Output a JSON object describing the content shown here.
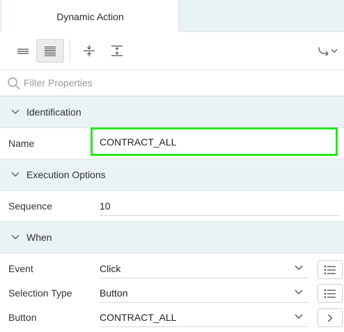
{
  "tabs": [
    {
      "label": "Dynamic Action"
    }
  ],
  "toolbar": {
    "buttons": [
      {
        "icon": "show-common-icon"
      },
      {
        "icon": "show-all-icon",
        "active": true
      },
      {
        "icon": "collapse-all-icon"
      },
      {
        "icon": "expand-all-icon"
      },
      {
        "icon": "go-to-group-icon"
      }
    ]
  },
  "filter": {
    "placeholder": "Filter Properties",
    "value": ""
  },
  "sections": {
    "identification": {
      "title": "Identification",
      "name_label": "Name",
      "name_value": "CONTRACT_ALL"
    },
    "execution": {
      "title": "Execution Options",
      "sequence_label": "Sequence",
      "sequence_value": "10"
    },
    "when": {
      "title": "When",
      "event_label": "Event",
      "event_value": "Click",
      "selection_type_label": "Selection Type",
      "selection_type_value": "Button",
      "button_label": "Button",
      "button_value": "CONTRACT_ALL"
    }
  },
  "colors": {
    "highlight": "#22e81f",
    "section_bg": "#eaf3f4"
  }
}
